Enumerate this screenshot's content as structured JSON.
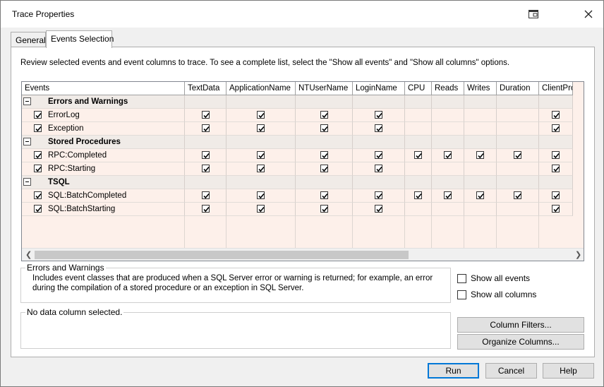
{
  "window": {
    "title": "Trace Properties",
    "restore_icon": "window-icon",
    "close_icon": "close-icon"
  },
  "tabs": [
    {
      "label": "General",
      "active": false
    },
    {
      "label": "Events Selection",
      "active": true
    }
  ],
  "description": "Review selected events and event columns to trace. To see a complete list, select the \"Show all events\" and \"Show all columns\" options.",
  "grid": {
    "columns": [
      "Events",
      "TextData",
      "ApplicationName",
      "NTUserName",
      "LoginName",
      "CPU",
      "Reads",
      "Writes",
      "Duration",
      "ClientProcessI"
    ],
    "rows": [
      {
        "type": "category",
        "label": "Errors and Warnings"
      },
      {
        "type": "event",
        "label": "ErrorLog",
        "checked": true,
        "cols": [
          true,
          true,
          true,
          true,
          false,
          false,
          false,
          false,
          true
        ]
      },
      {
        "type": "event",
        "label": "Exception",
        "checked": true,
        "cols": [
          true,
          true,
          true,
          true,
          false,
          false,
          false,
          false,
          true
        ]
      },
      {
        "type": "category",
        "label": "Stored Procedures"
      },
      {
        "type": "event",
        "label": "RPC:Completed",
        "checked": true,
        "cols": [
          true,
          true,
          true,
          true,
          true,
          true,
          true,
          true,
          true
        ]
      },
      {
        "type": "event",
        "label": "RPC:Starting",
        "checked": true,
        "cols": [
          true,
          true,
          true,
          true,
          false,
          false,
          false,
          false,
          true
        ]
      },
      {
        "type": "category",
        "label": "TSQL"
      },
      {
        "type": "event",
        "label": "SQL:BatchCompleted",
        "checked": true,
        "cols": [
          true,
          true,
          true,
          true,
          true,
          true,
          true,
          true,
          true
        ]
      },
      {
        "type": "event",
        "label": "SQL:BatchStarting",
        "checked": true,
        "cols": [
          true,
          true,
          true,
          true,
          false,
          false,
          false,
          false,
          true
        ]
      }
    ]
  },
  "info_group": {
    "title": "Errors and Warnings",
    "text": "Includes event classes that are produced when a SQL Server error or warning is returned; for example, an error during the compilation of a stored procedure or an exception in SQL Server."
  },
  "column_group": {
    "title": "No data column selected."
  },
  "options": {
    "show_all_events": {
      "label": "Show all events",
      "checked": false
    },
    "show_all_columns": {
      "label": "Show all columns",
      "checked": false
    }
  },
  "buttons": {
    "column_filters": "Column Filters...",
    "organize_columns": "Organize Columns...",
    "run": "Run",
    "cancel": "Cancel",
    "help": "Help"
  }
}
